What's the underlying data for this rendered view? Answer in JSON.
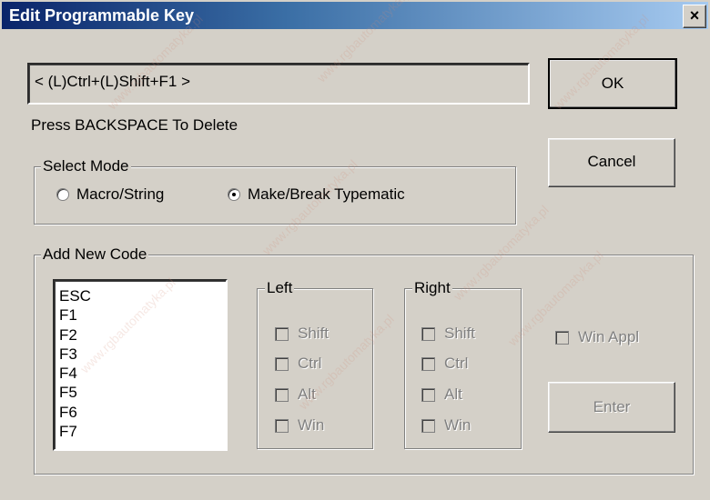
{
  "window": {
    "title": "Edit Programmable Key",
    "close_label": "×"
  },
  "key_sequence": "< (L)Ctrl+(L)Shift+F1 >",
  "hint": "Press BACKSPACE To Delete",
  "mode": {
    "label": "Select Mode",
    "options": [
      "Macro/String",
      "Make/Break Typematic"
    ],
    "selected": "Make/Break Typematic"
  },
  "buttons": {
    "ok": "OK",
    "cancel": "Cancel",
    "enter": "Enter"
  },
  "add_new_code": {
    "label": "Add New Code",
    "list": [
      "ESC",
      "F1",
      "F2",
      "F3",
      "F4",
      "F5",
      "F6",
      "F7"
    ]
  },
  "left_group": {
    "label": "Left",
    "options": [
      "Shift",
      "Ctrl",
      "Alt",
      "Win"
    ]
  },
  "right_group": {
    "label": "Right",
    "options": [
      "Shift",
      "Ctrl",
      "Alt",
      "Win"
    ]
  },
  "win_appl": "Win Appl",
  "watermark": "www.rgbautomatyka.pl",
  "icons": {
    "close": "close-icon",
    "up": "scroll-up-arrow-icon",
    "down": "scroll-down-arrow-icon"
  }
}
